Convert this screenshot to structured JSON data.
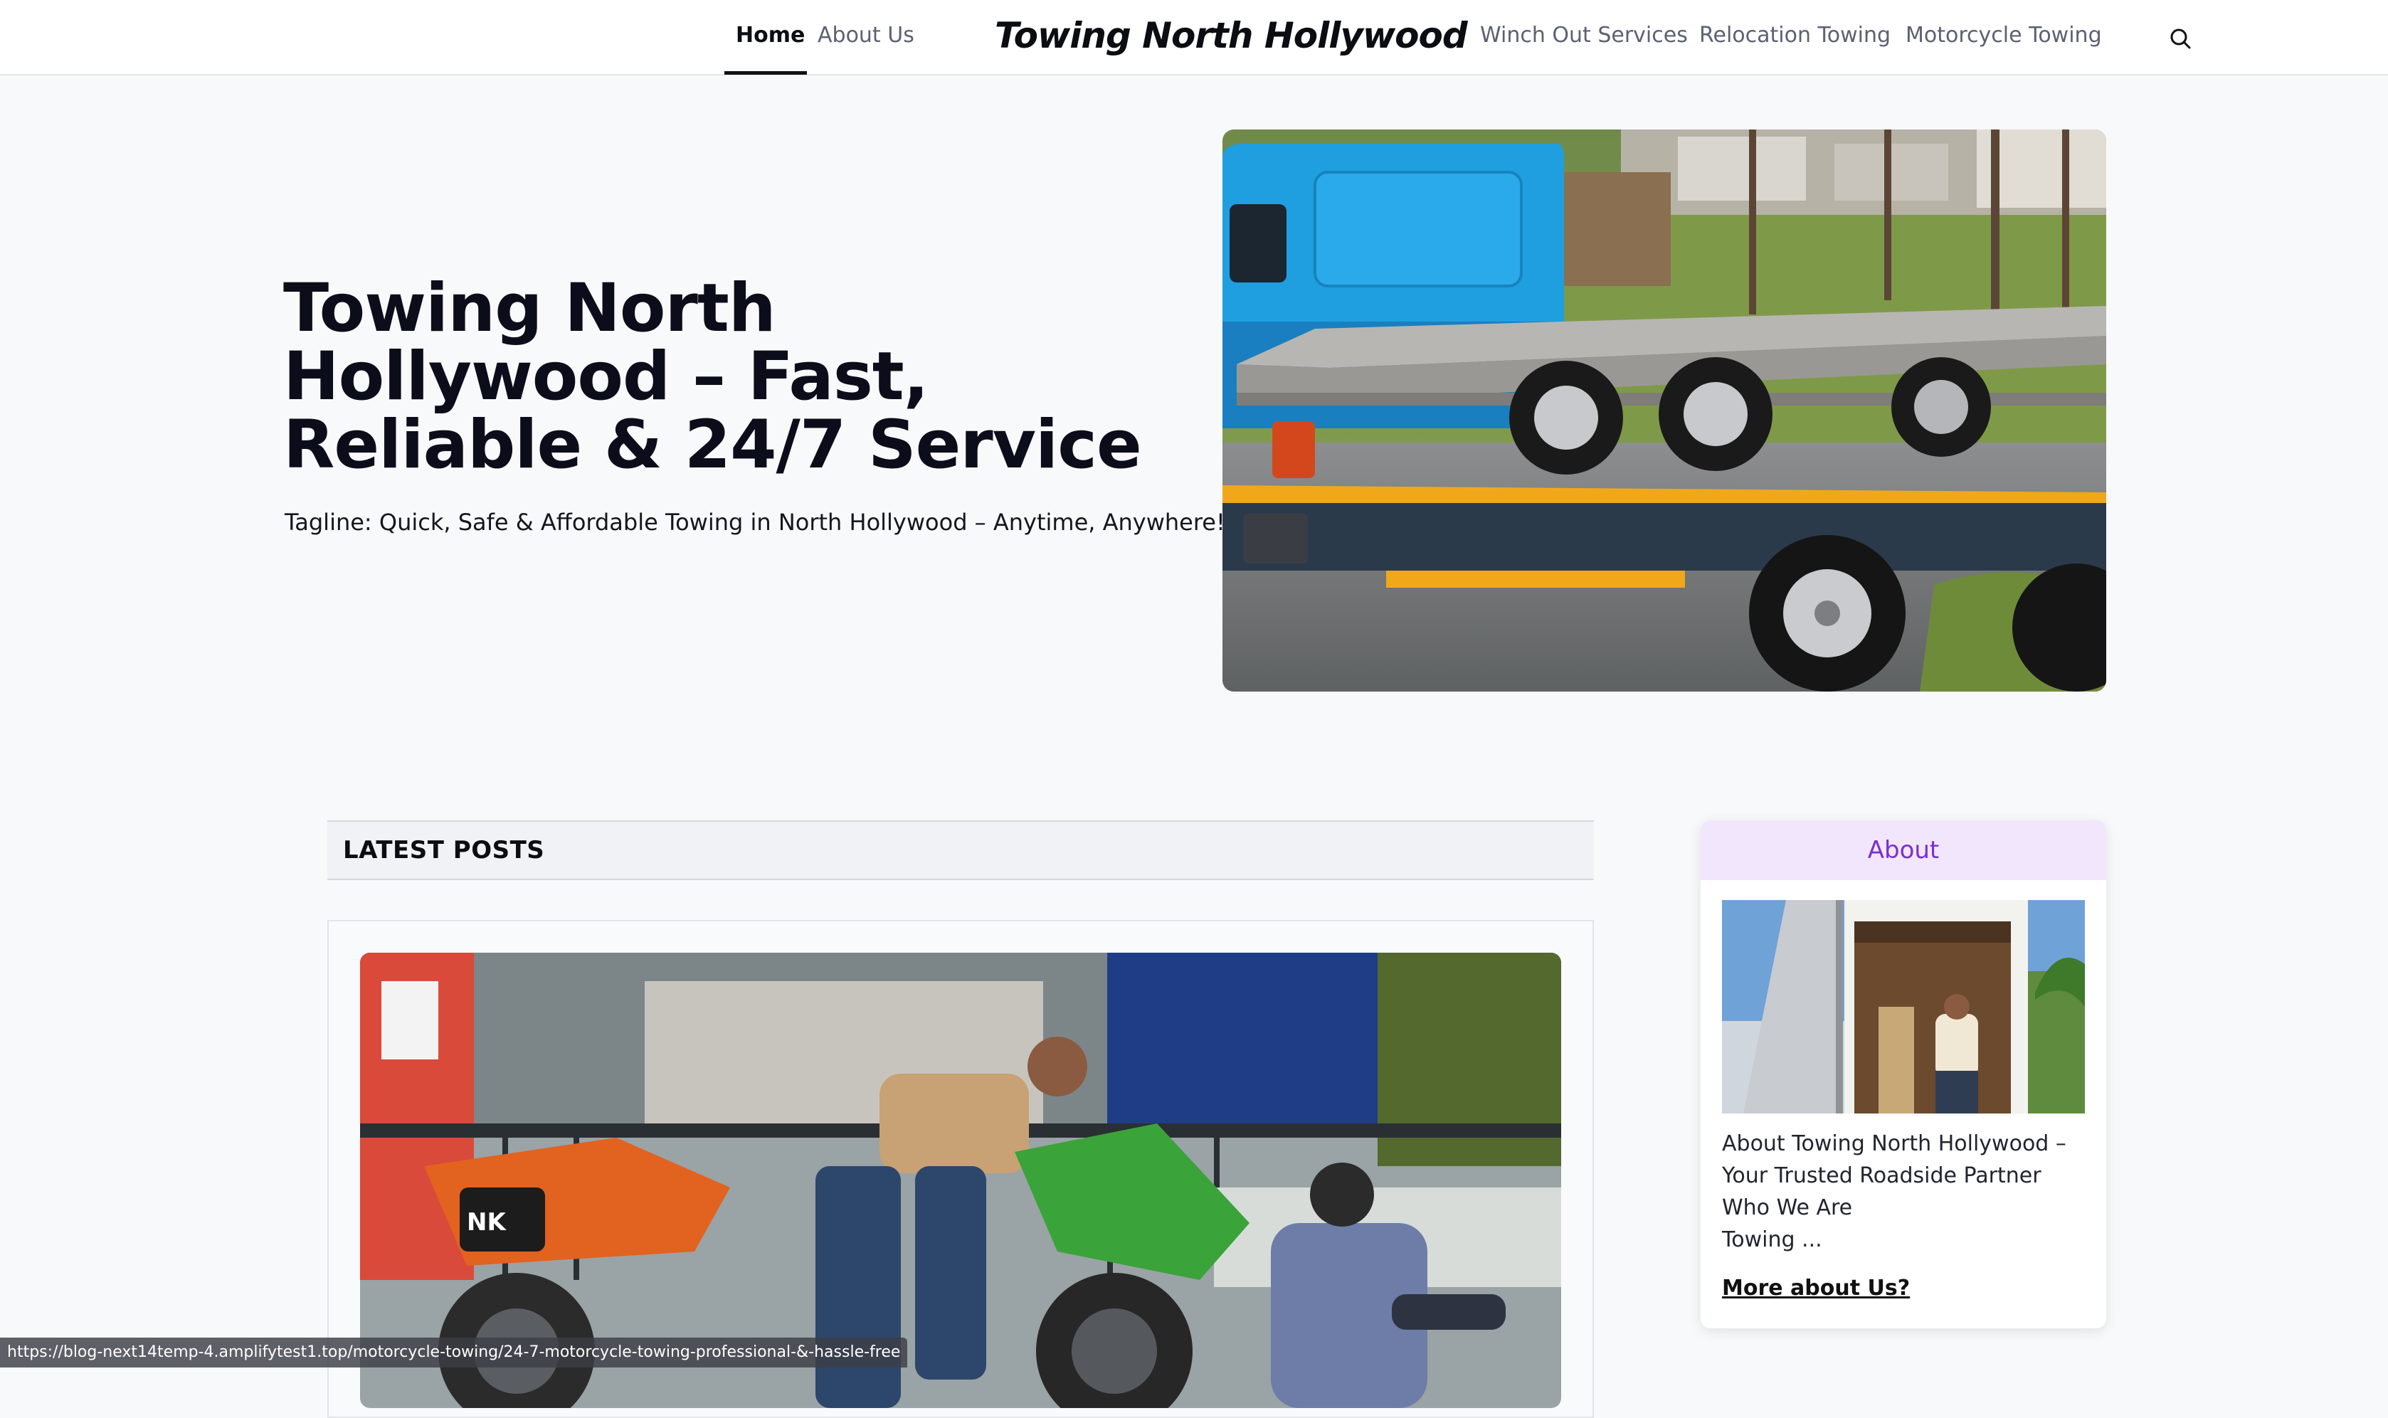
{
  "nav": {
    "left_items": [
      {
        "label": "Home",
        "active": true
      },
      {
        "label": "About Us",
        "active": false
      }
    ],
    "brand": "Towing North Hollywood",
    "right_items": [
      {
        "label": "Winch Out Services"
      },
      {
        "label": "Relocation Towing"
      },
      {
        "label": "Motorcycle Towing"
      }
    ],
    "search_icon": "search-icon"
  },
  "hero": {
    "title": "Towing North Hollywood – Fast, Reliable & 24/7 Service",
    "tagline": "Tagline: Quick, Safe & Affordable Towing in North Hollywood – Anytime, Anywhere!",
    "image_subject": "blue flatbed tow truck"
  },
  "latest": {
    "header": "LATEST POSTS",
    "post_image_subject": "men loading motorcycles onto a truck"
  },
  "about": {
    "title": "About",
    "text_lines": [
      "About Towing North Hollywood –",
      "Your Trusted Roadside Partner",
      "Who We Are",
      "Towing ..."
    ],
    "more_link": "More about Us?"
  },
  "status_bar": {
    "url": "https://blog-next14temp-4.amplifytest1.top/motorcycle-towing/24-7-motorcycle-towing-professional-&-hassle-free"
  },
  "colors": {
    "page_bg": "#f8f9fb",
    "about_accent": "#7b2fd0",
    "about_head_bg": "#f1e6fb"
  }
}
